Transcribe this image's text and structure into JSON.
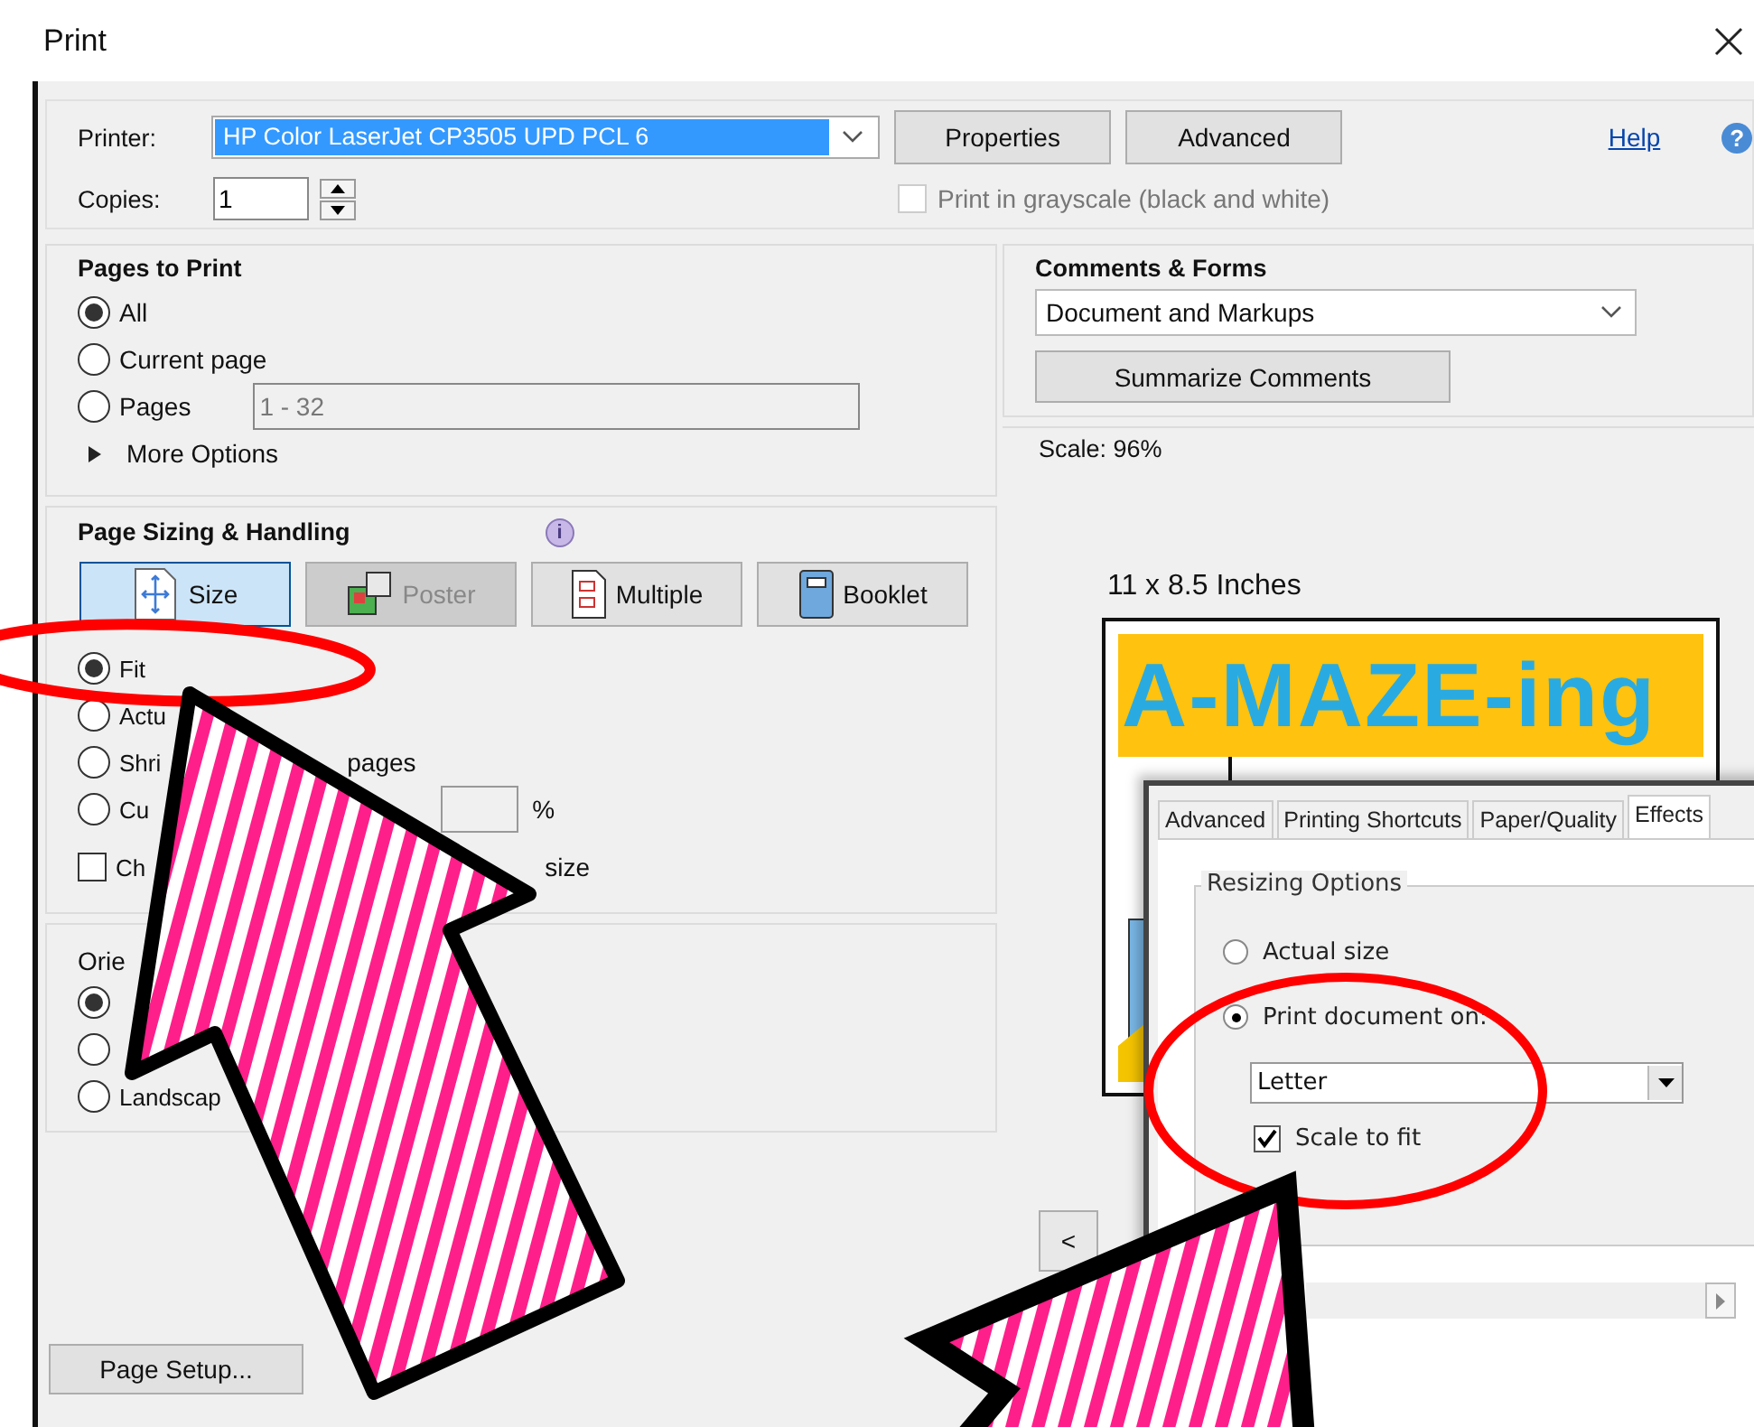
{
  "window": {
    "title": "Print"
  },
  "printer": {
    "label": "Printer:",
    "value": "HP Color LaserJet CP3505 UPD PCL 6",
    "buttons": [
      "Properties",
      "Advanced"
    ],
    "help": "Help",
    "help_icon": "?"
  },
  "copies": {
    "label": "Copies:",
    "value": "1"
  },
  "grayscale": {
    "label": "Print in grayscale (black and white)",
    "checked": false,
    "disabled": true
  },
  "pages_to_print": {
    "title": "Pages to Print",
    "options": [
      {
        "label": "All",
        "selected": true
      },
      {
        "label": "Current page",
        "selected": false
      },
      {
        "label": "Pages",
        "selected": false
      }
    ],
    "pages_field": "1 - 32",
    "more_options": {
      "label": "More Options",
      "expanded": false
    }
  },
  "page_sizing": {
    "title": "Page Sizing & Handling",
    "info_icon": "i",
    "modes": [
      {
        "kind": "size",
        "label": "Size",
        "selected": true,
        "disabled": false
      },
      {
        "kind": "poster",
        "label": "Poster",
        "selected": false,
        "disabled": true
      },
      {
        "kind": "multiple",
        "label": "Multiple",
        "selected": false,
        "disabled": false
      },
      {
        "kind": "booklet",
        "label": "Booklet",
        "selected": false,
        "disabled": false
      }
    ],
    "options": [
      {
        "kind": "radio",
        "label": "Fit",
        "selected": true
      },
      {
        "kind": "radio",
        "label": "Actu",
        "selected": false
      },
      {
        "kind": "radio",
        "label": "Shri",
        "tail": "pages",
        "selected": false
      },
      {
        "kind": "radio-field",
        "label": "Cu",
        "unit": "%",
        "selected": false
      },
      {
        "kind": "checkbox",
        "label": "Ch",
        "tail": "size",
        "checked": false
      }
    ]
  },
  "orientation": {
    "title": "Orie",
    "options": [
      {
        "selected": true
      },
      {
        "selected": false
      },
      {
        "label": "Landscap",
        "selected": false
      }
    ]
  },
  "page_setup": "Page Setup...",
  "comments_forms": {
    "title": "Comments & Forms",
    "value": "Document and Markups",
    "button": "Summarize Comments"
  },
  "preview": {
    "scale": "Scale:  96%",
    "size": "11 x 8.5 Inches",
    "page_title": "A-MAZE-ing",
    "prev_button": "<"
  },
  "inset_dialog": {
    "tabs": [
      {
        "label": "Advanced",
        "selected": false
      },
      {
        "label": "Printing Shortcuts",
        "selected": false
      },
      {
        "label": "Paper/Quality",
        "selected": false
      },
      {
        "label": "Effects",
        "selected": true
      }
    ],
    "group": "Resizing Options",
    "options": [
      {
        "kind": "radio",
        "label": "Actual size",
        "selected": false
      },
      {
        "kind": "radio",
        "label": "Print document on:",
        "selected": true
      },
      {
        "kind": "select",
        "value": "Letter"
      },
      {
        "kind": "checkbox",
        "label": "Scale to fit",
        "checked": true
      }
    ]
  }
}
